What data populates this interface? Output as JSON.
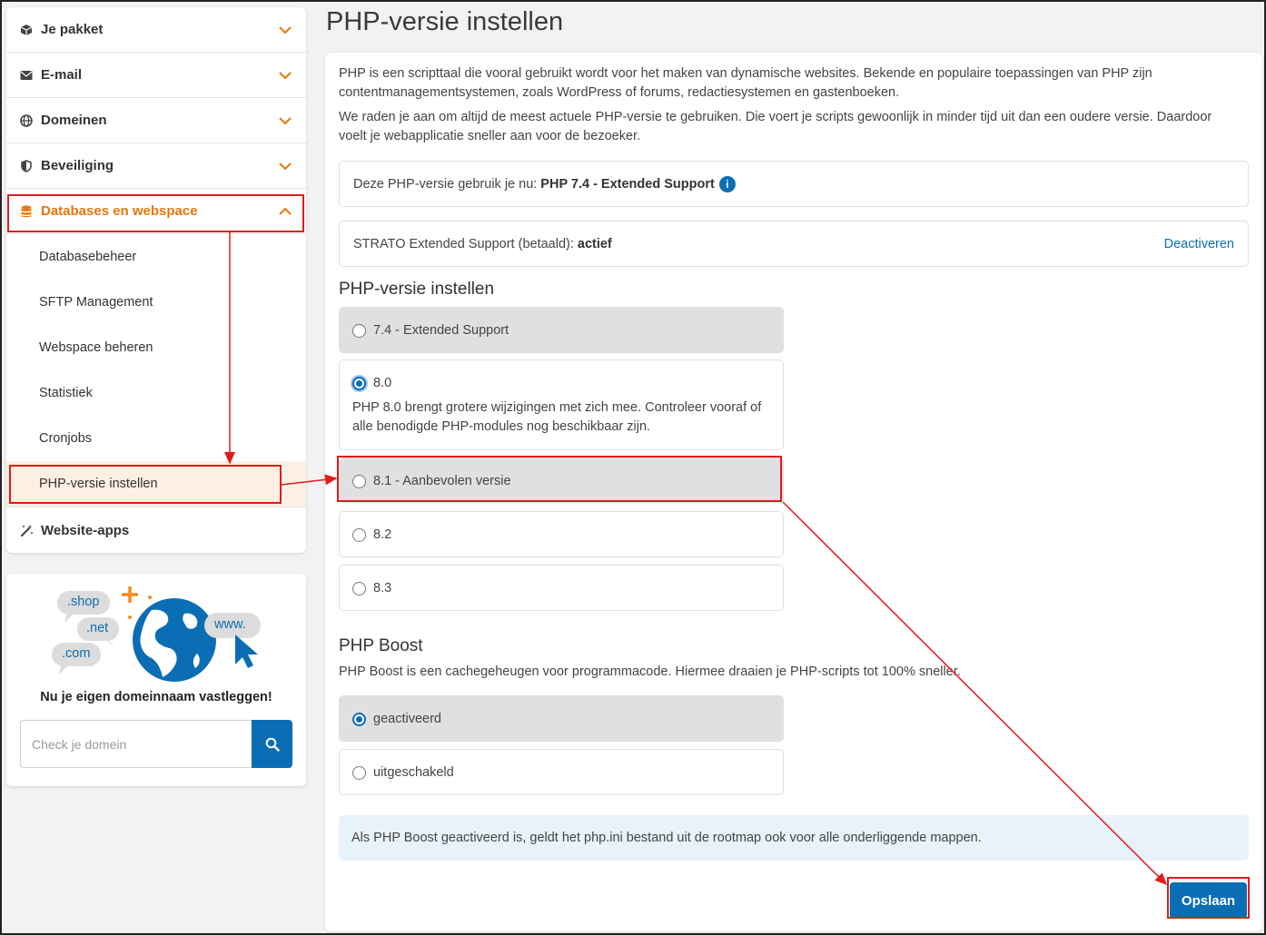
{
  "sidebar": {
    "items": [
      {
        "label": "Je pakket"
      },
      {
        "label": "E-mail"
      },
      {
        "label": "Domeinen"
      },
      {
        "label": "Beveiliging"
      },
      {
        "label": "Databases en webspace"
      }
    ],
    "sub_items": [
      {
        "label": "Databasebeheer"
      },
      {
        "label": "SFTP Management"
      },
      {
        "label": "Webspace beheren"
      },
      {
        "label": "Statistiek"
      },
      {
        "label": "Cronjobs"
      },
      {
        "label": "PHP-versie instellen"
      }
    ],
    "last_item": {
      "label": "Website-apps"
    }
  },
  "promo": {
    "bubbles": [
      ".shop",
      ".net",
      ".com",
      "www."
    ],
    "title": "Nu je eigen domeinnaam vastleggen!",
    "placeholder": "Check je domein"
  },
  "main": {
    "title": "PHP-versie instellen",
    "intro1": "PHP is een scripttaal die vooral gebruikt wordt voor het maken van dynamische websites. Bekende en populaire toepassingen van PHP zijn contentmanagementsystemen, zoals WordPress of forums, redactiesystemen en gastenboeken.",
    "intro2": "We raden je aan om altijd de meest actuele PHP-versie te gebruiken. Die voert je scripts gewoonlijk in minder tijd uit dan een oudere versie. Daardoor voelt je webapplicatie sneller aan voor de bezoeker.",
    "current_label": "Deze PHP-versie gebruik je nu:",
    "current_value": "PHP 7.4 - Extended Support",
    "support_label": "STRATO Extended Support (betaald):",
    "support_value": "actief",
    "deactivate": "Deactiveren",
    "section_title": "PHP-versie instellen",
    "versions": [
      {
        "label": "7.4 - Extended Support"
      },
      {
        "label": "8.0",
        "desc": "PHP 8.0 brengt grotere wijzigingen met zich mee. Controleer vooraf of alle benodigde PHP-modules nog beschikbaar zijn."
      },
      {
        "label": "8.1 - Aanbevolen versie"
      },
      {
        "label": "8.2"
      },
      {
        "label": "8.3"
      }
    ],
    "selected_version": "8.0",
    "boost_title": "PHP Boost",
    "boost_desc": "PHP Boost is een cachegeheugen voor programmacode. Hiermee draaien je PHP-scripts tot 100% sneller.",
    "boost_options": [
      {
        "label": "geactiveerd"
      },
      {
        "label": "uitgeschakeld"
      }
    ],
    "boost_selected": "geactiveerd",
    "note": "Als PHP Boost geactiveerd is, geldt het php.ini bestand uit de rootmap ook voor alle onderliggende mappen.",
    "save": "Opslaan"
  },
  "colors": {
    "accent_orange": "#e8750a",
    "primary_blue": "#0b6eb4",
    "annotation_red": "#e01b1b"
  }
}
